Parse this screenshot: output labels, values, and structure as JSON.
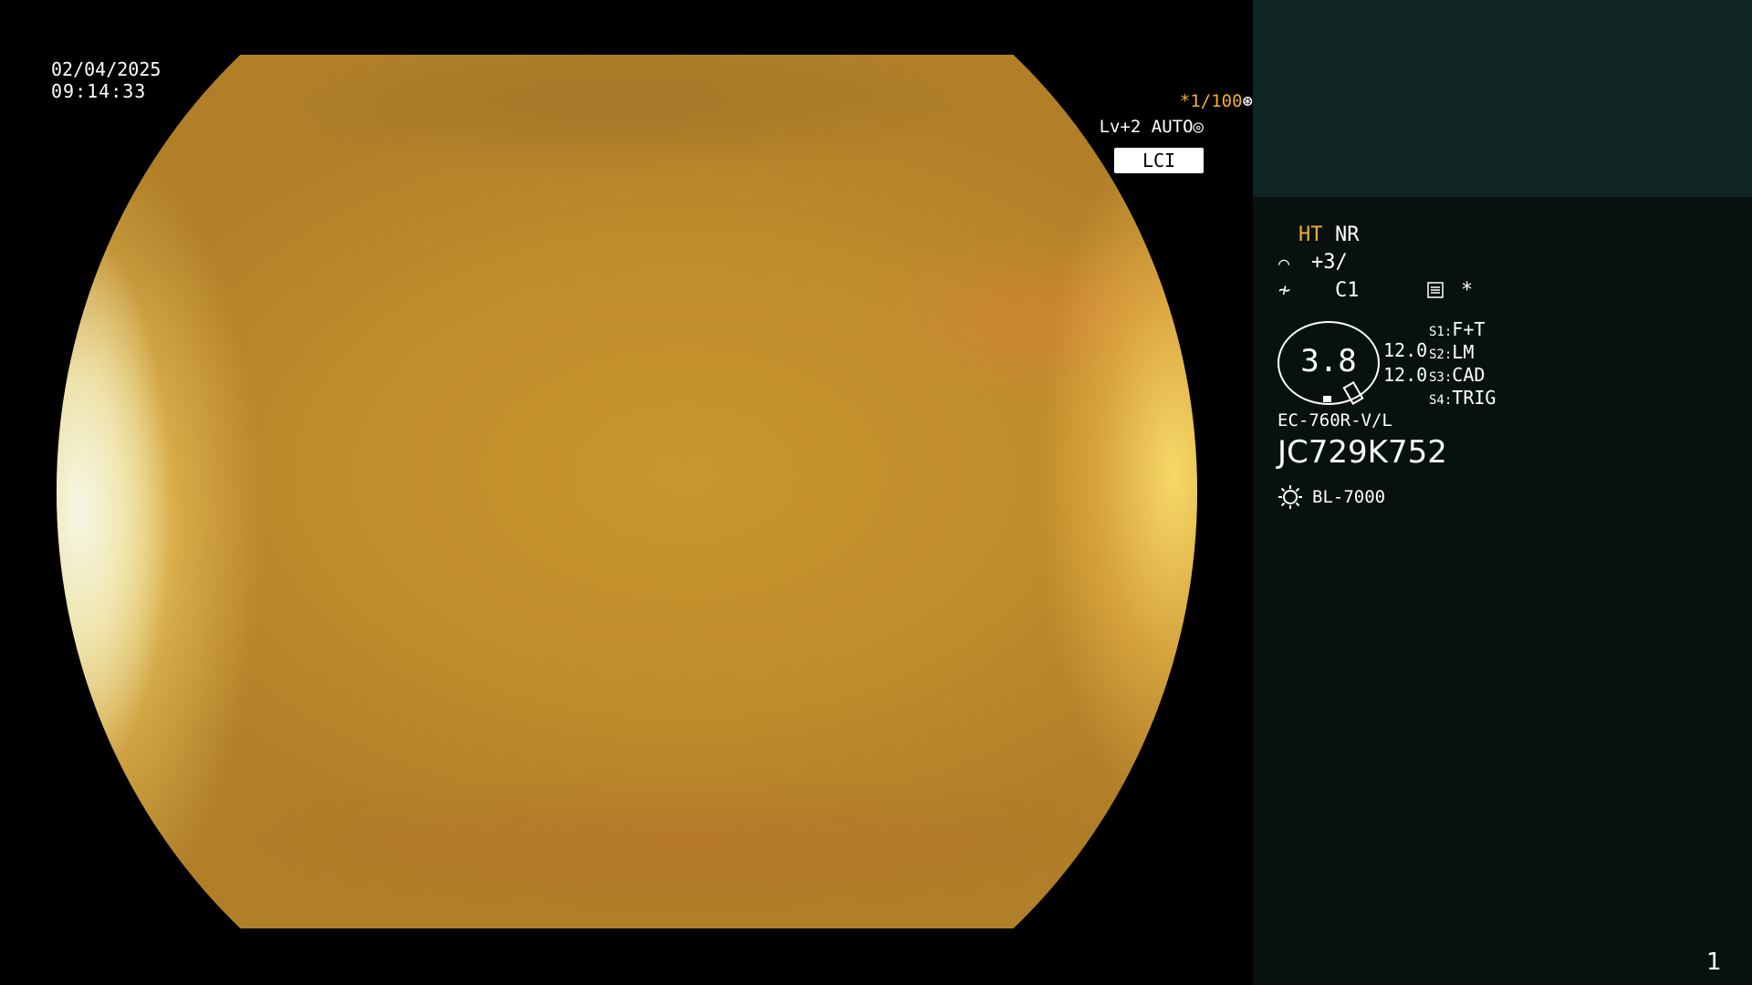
{
  "datetime": {
    "date": "02/04/2025",
    "time": "09:14:33"
  },
  "view_overlay": {
    "shutter": "*1/100",
    "level": "Lv+2 AUTO",
    "mode": "LCI"
  },
  "panel": {
    "structure_mode": "HT",
    "noise_reduction": "NR",
    "enhancement": "+3/",
    "color_mode": "C1",
    "star": "*",
    "zoom": "3.8",
    "magnification": [
      "12.0",
      "12.0"
    ],
    "switches": [
      {
        "id": "S1",
        "sep": ":",
        "value": "F+T"
      },
      {
        "id": "S2",
        "sep": ":",
        "value": "LM"
      },
      {
        "id": "S3",
        "sep": ":",
        "value": "CAD"
      },
      {
        "id": "S4",
        "sep": ":",
        "value": "TRIG"
      }
    ],
    "scope_model": "EC-760R-V/L",
    "scope_serial": "JC729K752",
    "light_source": "BL-7000",
    "page_number": "1"
  },
  "colors": {
    "panel_bg": "#07120f",
    "panel_top_bg": "#0f2524",
    "accent_amber": "#f0b030",
    "text": "#ffffff"
  },
  "icons": {
    "shutter": "aperture-icon",
    "level": "iris-icon",
    "enhancement": "sharpness-icon",
    "color": "color-mode-icon",
    "menu": "settings-panel-icon",
    "light": "light-source-icon"
  }
}
